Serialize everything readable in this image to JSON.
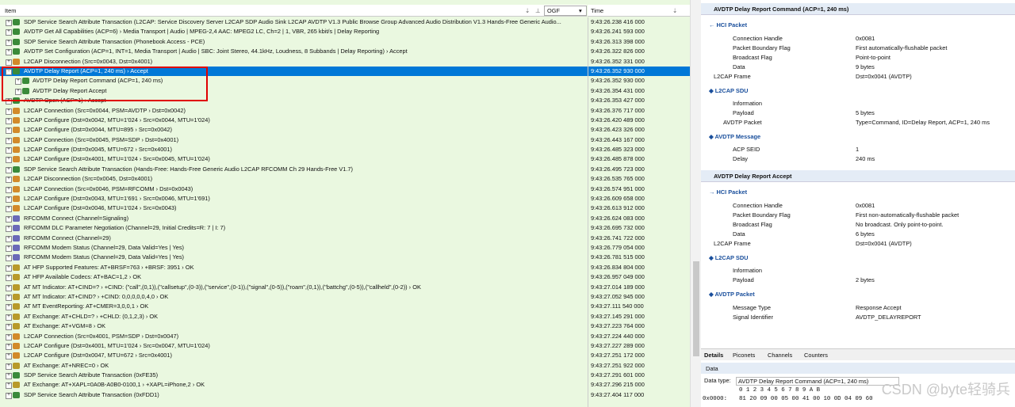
{
  "columns": {
    "item": "Item",
    "time": "Time",
    "filter_value": "OGF"
  },
  "rows": [
    {
      "text": "SDP Service Search Attribute Transaction (L2CAP: Service Discovery Server L2CAP SDP Audio Sink L2CAP AVDTP V1.3 Public Browse Group Advanced Audio Distribution V1.3 Hands-Free Generic Audio...",
      "time": "9:43:26.238 416 000",
      "color": "#3a8a3a"
    },
    {
      "text": "AVDTP Get All Capabilities (ACP=6) › Media Transport | Audio | MPEG-2,4 AAC: MPEG2 LC, Ch=2 | 1, VBR, 265 kbit/s | Delay Reporting",
      "time": "9:43:26.241 593 000",
      "color": "#3a8a3a"
    },
    {
      "text": "SDP Service Search Attribute Transaction (Phonebook Access - PCE)",
      "time": "9:43:26.313 398 000",
      "color": "#3a8a3a"
    },
    {
      "text": "AVDTP Set Configuration (ACP=1, INT=1, Media Transport | Audio | SBC: Joint Stereo, 44.1kHz, Loudness, 8 Subbands | Delay Reporting) › Accept",
      "time": "9:43:26.322 826 000",
      "color": "#3a8a3a"
    },
    {
      "text": "L2CAP Disconnection (Src=0x0043, Dst=0x4001)",
      "time": "9:43:26.352 331 000",
      "color": "#d28a2a"
    },
    {
      "text": "AVDTP Delay Report (ACP=1, 240 ms) › Accept",
      "time": "9:43:26.352 930 000",
      "color": "#3a8a3a",
      "selected": true
    },
    {
      "text": "AVDTP Delay Report Command (ACP=1, 240 ms)",
      "time": "9:43:26.352 930 000",
      "color": "#3a8a3a",
      "child": true
    },
    {
      "text": "AVDTP Delay Report Accept",
      "time": "9:43:26.354 431 000",
      "color": "#3a8a3a",
      "child": true
    },
    {
      "text": "AVDTP Open (ACP=1) › Accept",
      "time": "9:43:26.353 427 000",
      "color": "#3a8a3a"
    },
    {
      "text": "L2CAP Connection (Src=0x0044, PSM=AVDTP › Dst=0x0042)",
      "time": "9:43:26.376 717 000",
      "color": "#d28a2a"
    },
    {
      "text": "L2CAP Configure (Dst=0x0042, MTU=1'024 › Src=0x0044, MTU=1'024)",
      "time": "9:43:26.420 489 000",
      "color": "#d28a2a"
    },
    {
      "text": "L2CAP Configure (Dst=0x0044, MTU=895 › Src=0x0042)",
      "time": "9:43:26.423 326 000",
      "color": "#d28a2a"
    },
    {
      "text": "L2CAP Connection (Src=0x0045, PSM=SDP › Dst=0x4001)",
      "time": "9:43:26.443 167 000",
      "color": "#d28a2a"
    },
    {
      "text": "L2CAP Configure (Dst=0x0045, MTU=672 › Src=0x4001)",
      "time": "9:43:26.485 323 000",
      "color": "#d28a2a"
    },
    {
      "text": "L2CAP Configure (Dst=0x4001, MTU=1'024 › Src=0x0045, MTU=1'024)",
      "time": "9:43:26.485 878 000",
      "color": "#d28a2a"
    },
    {
      "text": "SDP Service Search Attribute Transaction (Hands-Free: Hands-Free Generic Audio L2CAP RFCOMM Ch 29 Hands-Free V1.7)",
      "time": "9:43:26.495 723 000",
      "color": "#3a8a3a"
    },
    {
      "text": "L2CAP Disconnection (Src=0x0045, Dst=0x4001)",
      "time": "9:43:26.535 765 000",
      "color": "#d28a2a"
    },
    {
      "text": "L2CAP Connection (Src=0x0046, PSM=RFCOMM › Dst=0x0043)",
      "time": "9:43:26.574 951 000",
      "color": "#d28a2a"
    },
    {
      "text": "L2CAP Configure (Dst=0x0043, MTU=1'691 › Src=0x0046, MTU=1'691)",
      "time": "9:43:26.609 658 000",
      "color": "#d28a2a"
    },
    {
      "text": "L2CAP Configure (Dst=0x0046, MTU=1'024 › Src=0x0043)",
      "time": "9:43:26.613 912 000",
      "color": "#d28a2a"
    },
    {
      "text": "RFCOMM Connect (Channel=Signaling)",
      "time": "9:43:26.624 083 000",
      "color": "#6a6ab8"
    },
    {
      "text": "RFCOMM DLC Parameter Negotiation (Channel=29, Initial Credits=R: 7 | I: 7)",
      "time": "9:43:26.695 732 000",
      "color": "#6a6ab8"
    },
    {
      "text": "RFCOMM Connect (Channel=29)",
      "time": "9:43:26.741 722 000",
      "color": "#6a6ab8"
    },
    {
      "text": "RFCOMM Modem Status (Channel=29, Data Valid=Yes | Yes)",
      "time": "9:43:26.779 054 000",
      "color": "#6a6ab8"
    },
    {
      "text": "RFCOMM Modem Status (Channel=29, Data Valid=Yes | Yes)",
      "time": "9:43:26.781 515 000",
      "color": "#6a6ab8"
    },
    {
      "text": "AT HFP Supported Features: AT+BRSF=763 › +BRSF: 3951 › OK",
      "time": "9:43:26.834 804 000",
      "color": "#b89a2a"
    },
    {
      "text": "AT HFP Available Codecs: AT+BAC=1,2 › OK",
      "time": "9:43:26.957 049 000",
      "color": "#b89a2a"
    },
    {
      "text": "AT MT Indicator: AT+CIND=? › +CIND: (\"call\",(0,1)),(\"callsetup\",(0-3)),(\"service\",(0-1)),(\"signal\",(0-5)),(\"roam\",(0,1)),(\"battchg\",(0-5)),(\"callheld\",(0-2)) › OK",
      "time": "9:43:27.014 189 000",
      "color": "#b89a2a"
    },
    {
      "text": "AT MT Indicator: AT+CIND? › +CIND: 0,0,0,0,0,4,0 › OK",
      "time": "9:43:27.052 945 000",
      "color": "#b89a2a"
    },
    {
      "text": "AT MT EventReporting: AT+CMER=3,0,0,1 › OK",
      "time": "9:43:27.111 540 000",
      "color": "#b89a2a"
    },
    {
      "text": "AT Exchange: AT+CHLD=? › +CHLD: (0,1,2,3) › OK",
      "time": "9:43:27.145 291 000",
      "color": "#b89a2a"
    },
    {
      "text": "AT Exchange: AT+VGM=8 › OK",
      "time": "9:43:27.223 764 000",
      "color": "#b89a2a"
    },
    {
      "text": "L2CAP Connection (Src=0x4001, PSM=SDP › Dst=0x0047)",
      "time": "9:43:27.224 440 000",
      "color": "#d28a2a"
    },
    {
      "text": "L2CAP Configure (Dst=0x4001, MTU=1'024 › Src=0x0047, MTU=1'024)",
      "time": "9:43:27.227 289 000",
      "color": "#d28a2a"
    },
    {
      "text": "L2CAP Configure (Dst=0x0047, MTU=672 › Src=0x4001)",
      "time": "9:43:27.251 172 000",
      "color": "#d28a2a"
    },
    {
      "text": "AT Exchange: AT+NREC=0 › OK",
      "time": "9:43:27.251 922 000",
      "color": "#b89a2a"
    },
    {
      "text": "SDP Service Search Attribute Transaction (0xFE35)",
      "time": "9:43:27.291 601 000",
      "color": "#3a8a3a"
    },
    {
      "text": "AT Exchange: AT+XAPL=0A0B-A0B0-0100,1 › +XAPL=iPhone,2 › OK",
      "time": "9:43:27.296 215 000",
      "color": "#b89a2a"
    },
    {
      "text": "SDP Service Search Attribute Transaction (0xFDD1)",
      "time": "9:43:27.404 117 000",
      "color": "#3a8a3a"
    }
  ],
  "details": {
    "cmd_title": "AVDTP Delay Report Command (ACP=1, 240 ms)",
    "hci_packet": "HCI Packet",
    "ch_k": "Connection Handle",
    "ch_v": "0x0081",
    "pbf_k": "Packet Boundary Flag",
    "pbf_v": "First automatically-flushable packet",
    "bf_k": "Broadcast Flag",
    "bf_v": "Point-to-point",
    "data_k": "Data",
    "data_v": "9 bytes",
    "l2_k": "L2CAP Frame",
    "l2_v": "Dst=0x0041 (AVDTP)",
    "sdu": "L2CAP SDU",
    "info_k": "Information",
    "payload_k": "Payload",
    "payload_v": "5 bytes",
    "avp_k": "AVDTP Packet",
    "avp_v": "Type=Command, ID=Delay Report, ACP=1, 240 ms",
    "msg": "AVDTP Message",
    "seid_k": "ACP SEID",
    "seid_v": "1",
    "delay_k": "Delay",
    "delay_v": "240 ms",
    "acc_title": "AVDTP Delay Report Accept",
    "hci2": "HCI Packet",
    "ch2_k": "Connection Handle",
    "ch2_v": "0x0081",
    "pbf2_k": "Packet Boundary Flag",
    "pbf2_v": "First non-automatically-flushable packet",
    "bf2_k": "Broadcast Flag",
    "bf2_v": "No broadcast. Only point-to-point.",
    "data2_k": "Data",
    "data2_v": "6 bytes",
    "l22_k": "L2CAP Frame",
    "l22_v": "Dst=0x0041 (AVDTP)",
    "sdu2": "L2CAP SDU",
    "info2_k": "Information",
    "payload2_k": "Payload",
    "payload2_v": "2 bytes",
    "avp2": "AVDTP Packet",
    "mt_k": "Message Type",
    "mt_v": "Response Accept",
    "si_k": "Signal Identifier",
    "si_v": "AVDTP_DELAYREPORT"
  },
  "tabs": {
    "details": "Details",
    "piconets": "Piconets",
    "channels": "Channels",
    "counters": "Counters"
  },
  "data_panel": {
    "title": "Data",
    "type_label": "Data type:",
    "type_value": "AVDTP Delay Report Command (ACP=1, 240 ms)",
    "cols": "0  1  2  3  4  5  6  7  8  9  A  B",
    "addr": "0x0000:",
    "bytes": "81 20 09 00 05 00 41 00 10 0D 04 09 60"
  },
  "watermark": "CSDN @byte轻骑兵"
}
